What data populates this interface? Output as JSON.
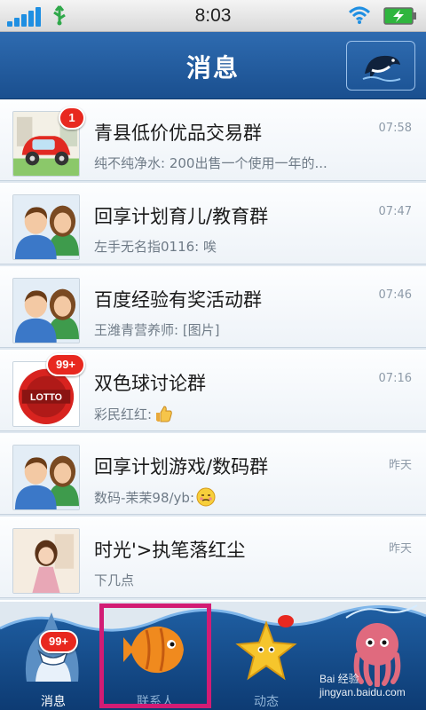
{
  "status_bar": {
    "time": "8:03",
    "icons": [
      "signal-icon",
      "usb-icon",
      "wifi-icon",
      "battery-charging-icon"
    ]
  },
  "header": {
    "title": "消息",
    "action_icon": "dolphin-icon"
  },
  "conversations": [
    {
      "name": "青县低价优品交易群",
      "time": "07:58",
      "preview": "纯不纯净水: 200出售一个使用一年的...",
      "badge": "1",
      "avatar": "car"
    },
    {
      "name": "回享计划育儿/教育群",
      "time": "07:47",
      "preview": "左手无名指0116: 唉",
      "badge": "",
      "avatar": "couple"
    },
    {
      "name": "百度经验有奖活动群",
      "time": "07:46",
      "preview": "王潍青营养师: [图片]",
      "badge": "",
      "avatar": "couple"
    },
    {
      "name": "双色球讨论群",
      "time": "07:16",
      "preview": "彩民红红:",
      "badge": "99+",
      "avatar": "lotto",
      "emoji": "thumbs-up"
    },
    {
      "name": "回享计划游戏/数码群",
      "time": "昨天",
      "preview": "数码-茉茉98/yb:",
      "badge": "",
      "avatar": "couple",
      "emoji": "shy-face"
    },
    {
      "name": "时光'>执笔落红尘",
      "time": "昨天",
      "preview": "下几点",
      "badge": "",
      "avatar": "girl"
    }
  ],
  "tabs": [
    {
      "label": "消息",
      "icon": "shark-icon",
      "badge": "99+",
      "active": true
    },
    {
      "label": "联系人",
      "icon": "fish-icon",
      "badge": "",
      "active": false
    },
    {
      "label": "动态",
      "icon": "starfish-icon",
      "badge": "",
      "active": false
    },
    {
      "label": "",
      "icon": "octopus-icon",
      "badge": "",
      "active": false
    }
  ],
  "watermark": "Bai 经验 jingyan.baidu.com",
  "colors": {
    "header": "#1f5a9c",
    "badge": "#e8281f",
    "highlight": "#d21c74"
  }
}
